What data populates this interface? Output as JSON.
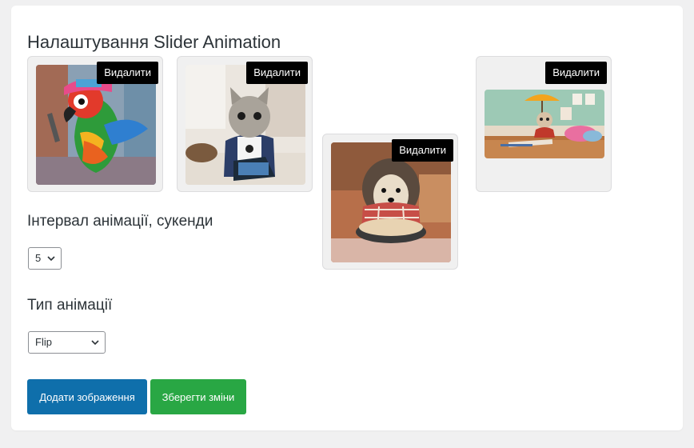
{
  "settings": {
    "title": "Налаштування Slider Animation",
    "images": [
      {
        "name": "parrot",
        "delete_label": "Видалити"
      },
      {
        "name": "kitten",
        "delete_label": "Видалити"
      },
      {
        "name": "hedgehog",
        "delete_label": "Видалити"
      },
      {
        "name": "cat-umbrella",
        "delete_label": "Видалити"
      }
    ],
    "interval": {
      "label": "Інтервал анімації, сукенди",
      "value": "5"
    },
    "animation_type": {
      "label": "Тип анімації",
      "value": "Flip"
    },
    "buttons": {
      "add_label": "Додати зображення",
      "save_label": "Зберегти зміни"
    },
    "colors": {
      "page_bg": "#f0f0f1",
      "add_button": "#0f6fab",
      "save_button": "#29a744",
      "delete_button": "#000000"
    }
  }
}
